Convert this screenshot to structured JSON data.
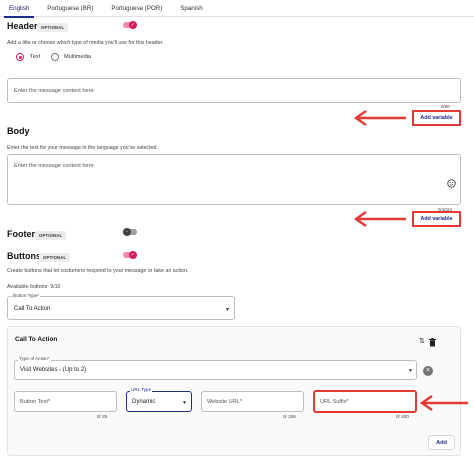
{
  "tabs": [
    {
      "label": "English"
    },
    {
      "label": "Portuguese (BR)"
    },
    {
      "label": "Portuguese (POR)"
    },
    {
      "label": "Spanish"
    }
  ],
  "header": {
    "title": "Header",
    "badge": "OPTIONAL",
    "toggle_on": true,
    "helper": "Add a title or choose which type of media you'll use for this header.",
    "radio_text": "Text",
    "radio_multimedia": "Multimedia",
    "input_placeholder": "Enter the message content here",
    "counter": "0/60",
    "add_variable": "Add variable"
  },
  "body": {
    "title": "Body",
    "helper": "Enter the text for your message in the language you've selected.",
    "input_placeholder": "Enter the message content here",
    "counter": "0/1024",
    "add_variable": "Add variable",
    "emoji_icon": "emoji-icon"
  },
  "footer": {
    "title": "Footer",
    "badge": "OPTIONAL",
    "toggle_on": false
  },
  "buttons": {
    "title": "Buttons",
    "badge": "OPTIONAL",
    "toggle_on": true,
    "helper": "Create buttons that let costumers respond to your message or take an action.",
    "available": "Available buttons: 9/10",
    "button_type_label": "Button Type*",
    "button_type_value": "Call To Action"
  },
  "cta": {
    "title": "Call To Action",
    "type_label": "Type of Action*",
    "type_value": "Visit Websites - (Up to 2)",
    "button_text_placeholder": "Button Text*",
    "button_text_counter": "0/ 25",
    "url_type_label": "URL Type",
    "url_type_value": "Dynamic",
    "website_url_placeholder": "Website URL*",
    "website_url_counter": "0/ 256",
    "url_suffix_placeholder": "URL Suffix*",
    "url_suffix_counter": "0/ 100",
    "add_label": "Add"
  },
  "colors": {
    "accent_pink": "#d81b60",
    "accent_blue": "#1e2b8f",
    "highlight_red": "#e53935"
  }
}
